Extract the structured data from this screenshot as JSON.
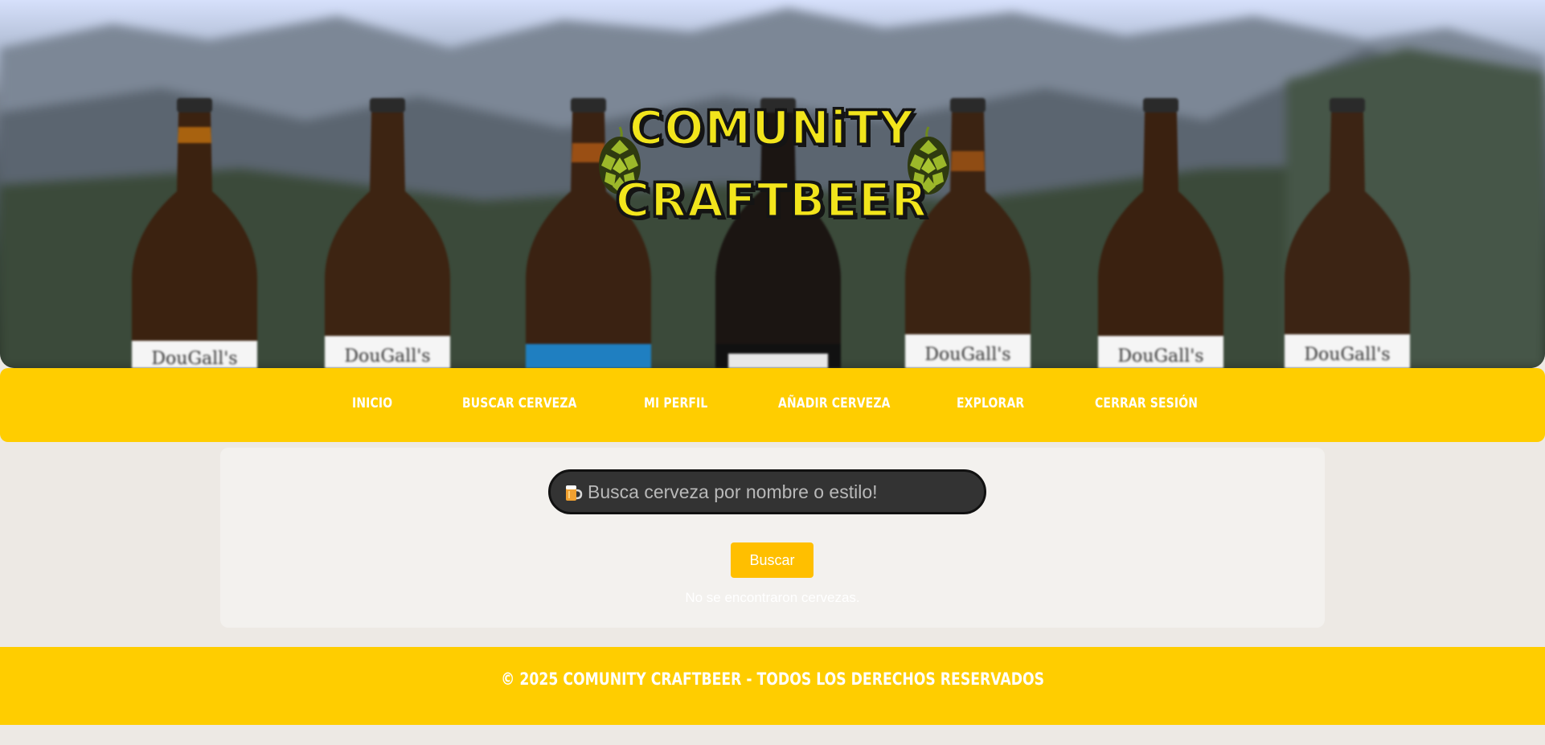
{
  "header": {
    "logo_line1": "COMUNiTY",
    "logo_line2": "CRAFTBEER",
    "bottle_label": "DouGall's"
  },
  "nav": {
    "items": [
      {
        "label": "INICIO"
      },
      {
        "label": "BUSCAR CERVEZA"
      },
      {
        "label": "MI PERFIL"
      },
      {
        "label": "AÑADIR CERVEZA"
      },
      {
        "label": "EXPLORAR"
      },
      {
        "label": "CERRAR SESIÓN"
      }
    ]
  },
  "search": {
    "icon": "beer-mug-icon",
    "placeholder": "Busca cerveza por nombre o estilo!",
    "value": "",
    "button_label": "Buscar",
    "no_results": "No se encontraron cervezas."
  },
  "footer": {
    "text": "© 2025 COMUNITY CRAFTBEER - TODOS LOS DERECHOS RESERVADOS"
  },
  "colors": {
    "accent_yellow": "#ffcd00",
    "button_yellow": "#ffbf00",
    "logo_yellow": "#f2e51c",
    "hop_green": "#9cb82a"
  }
}
